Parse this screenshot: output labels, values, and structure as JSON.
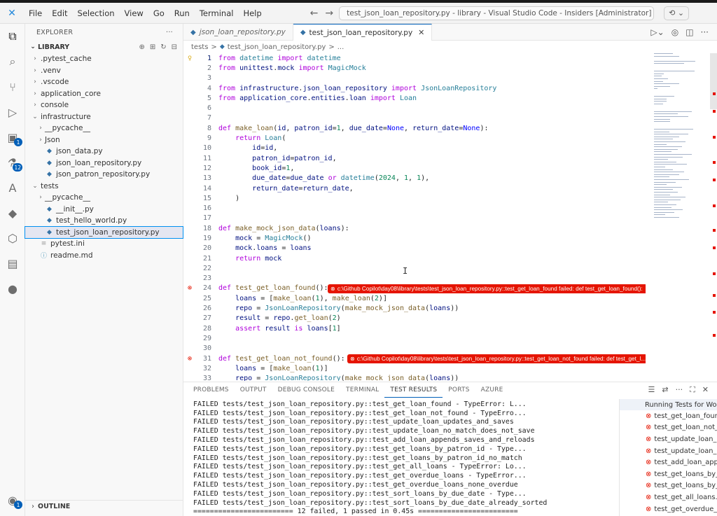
{
  "window": {
    "title": "test_json_loan_repository.py - library - Visual Studio Code - Insiders [Administrator]",
    "menu": [
      "File",
      "Edit",
      "Selection",
      "View",
      "Go",
      "Run",
      "Terminal",
      "Help"
    ]
  },
  "activity_bar": {
    "items": [
      {
        "name": "explorer-icon",
        "glyph": "⧉",
        "badge": ""
      },
      {
        "name": "search-icon",
        "glyph": "⌕",
        "badge": ""
      },
      {
        "name": "source-control-icon",
        "glyph": "⑂",
        "badge": ""
      },
      {
        "name": "run-debug-icon",
        "glyph": "▷",
        "badge": ""
      },
      {
        "name": "extensions-icon",
        "glyph": "▣",
        "badge": "1"
      },
      {
        "name": "testing-icon",
        "glyph": "⚗",
        "badge": "12"
      },
      {
        "name": "azure-icon",
        "glyph": "A",
        "badge": ""
      },
      {
        "name": "python-icon",
        "glyph": "◆",
        "badge": ""
      },
      {
        "name": "copilot-icon",
        "glyph": "⬡",
        "badge": ""
      },
      {
        "name": "m365-icon",
        "glyph": "▤",
        "badge": ""
      },
      {
        "name": "github-icon",
        "glyph": "●",
        "badge": ""
      }
    ],
    "account_badge": "1"
  },
  "sidebar": {
    "title": "EXPLORER",
    "section": "LIBRARY",
    "tree": [
      {
        "label": ".pytest_cache",
        "depth": 1,
        "kind": "folder-closed"
      },
      {
        "label": ".venv",
        "depth": 1,
        "kind": "folder-closed"
      },
      {
        "label": ".vscode",
        "depth": 1,
        "kind": "folder-closed"
      },
      {
        "label": "application_core",
        "depth": 1,
        "kind": "folder-closed"
      },
      {
        "label": "console",
        "depth": 1,
        "kind": "folder-closed"
      },
      {
        "label": "infrastructure",
        "depth": 1,
        "kind": "folder-open"
      },
      {
        "label": "__pycache__",
        "depth": 2,
        "kind": "folder-closed"
      },
      {
        "label": "Json",
        "depth": 2,
        "kind": "folder-closed"
      },
      {
        "label": "json_data.py",
        "depth": 2,
        "kind": "py"
      },
      {
        "label": "json_loan_repository.py",
        "depth": 2,
        "kind": "py"
      },
      {
        "label": "json_patron_repository.py",
        "depth": 2,
        "kind": "py"
      },
      {
        "label": "tests",
        "depth": 1,
        "kind": "folder-open"
      },
      {
        "label": "__pycache__",
        "depth": 2,
        "kind": "folder-closed"
      },
      {
        "label": "__init__.py",
        "depth": 2,
        "kind": "py"
      },
      {
        "label": "test_hello_world.py",
        "depth": 2,
        "kind": "py"
      },
      {
        "label": "test_json_loan_repository.py",
        "depth": 2,
        "kind": "py",
        "selected": true
      },
      {
        "label": "pytest.ini",
        "depth": 1,
        "kind": "ini"
      },
      {
        "label": "readme.md",
        "depth": 1,
        "kind": "md"
      }
    ],
    "outline": "OUTLINE"
  },
  "editor": {
    "tabs": [
      {
        "label": "json_loan_repository.py",
        "active": false
      },
      {
        "label": "test_json_loan_repository.py",
        "active": true
      }
    ],
    "breadcrumb": [
      "tests",
      ">",
      "test_json_loan_repository.py",
      ">",
      "..."
    ],
    "lines": [
      {
        "n": "1",
        "text": "from datetime import datetime",
        "gutter": "bulb"
      },
      {
        "n": "2",
        "text": "from unittest.mock import MagicMock"
      },
      {
        "n": "3",
        "text": ""
      },
      {
        "n": "4",
        "text": "from infrastructure.json_loan_repository import JsonLoanRepository"
      },
      {
        "n": "5",
        "text": "from application_core.entities.loan import Loan"
      },
      {
        "n": "6",
        "text": ""
      },
      {
        "n": "7",
        "text": ""
      },
      {
        "n": "8",
        "text": "def make_loan(id, patron_id=1, due_date=None, return_date=None):"
      },
      {
        "n": "9",
        "text": "    return Loan("
      },
      {
        "n": "10",
        "text": "        id=id,"
      },
      {
        "n": "11",
        "text": "        patron_id=patron_id,"
      },
      {
        "n": "12",
        "text": "        book_id=1,"
      },
      {
        "n": "13",
        "text": "        due_date=due_date or datetime(2024, 1, 1),"
      },
      {
        "n": "14",
        "text": "        return_date=return_date,"
      },
      {
        "n": "15",
        "text": "    )"
      },
      {
        "n": "16",
        "text": ""
      },
      {
        "n": "17",
        "text": ""
      },
      {
        "n": "18",
        "text": "def make_mock_json_data(loans):"
      },
      {
        "n": "19",
        "text": "    mock = MagicMock()"
      },
      {
        "n": "20",
        "text": "    mock.loans = loans"
      },
      {
        "n": "21",
        "text": "    return mock"
      },
      {
        "n": "22",
        "text": ""
      },
      {
        "n": "23",
        "text": ""
      },
      {
        "n": "24",
        "text": "def test_get_loan_found():",
        "gutter": "err",
        "error": "c:\\Github Copilot\\day08\\library\\tests\\test_json_loan_repository.py::test_get_loan_found failed: def test_get_loan_found():"
      },
      {
        "n": "25",
        "text": "    loans = [make_loan(1), make_loan(2)]"
      },
      {
        "n": "26",
        "text": "    repo = JsonLoanRepository(make_mock_json_data(loans))"
      },
      {
        "n": "27",
        "text": "    result = repo.get_loan(2)"
      },
      {
        "n": "28",
        "text": "    assert result is loans[1]"
      },
      {
        "n": "29",
        "text": ""
      },
      {
        "n": "30",
        "text": ""
      },
      {
        "n": "31",
        "text": "def test_get_loan_not_found():",
        "gutter": "err",
        "error": "c:\\Github Copilot\\day08\\library\\tests\\test_json_loan_repository.py::test_get_loan_not_found failed: def test_get_l..."
      },
      {
        "n": "32",
        "text": "    loans = [make_loan(1)]"
      },
      {
        "n": "33",
        "text": "    repo = JsonLoanRepository(make_mock_json_data(loans))"
      }
    ]
  },
  "panel": {
    "tabs": [
      "PROBLEMS",
      "OUTPUT",
      "DEBUG CONSOLE",
      "TERMINAL",
      "TEST RESULTS",
      "PORTS",
      "AZURE"
    ],
    "active_tab": "TEST RESULTS",
    "output": [
      "FAILED tests/test_json_loan_repository.py::test_get_loan_found - TypeError: L...",
      "FAILED tests/test_json_loan_repository.py::test_get_loan_not_found - TypeErro...",
      "FAILED tests/test_json_loan_repository.py::test_update_loan_updates_and_saves",
      "FAILED tests/test_json_loan_repository.py::test_update_loan_no_match_does_not_save",
      "FAILED tests/test_json_loan_repository.py::test_add_loan_appends_saves_and_reloads",
      "FAILED tests/test_json_loan_repository.py::test_get_loans_by_patron_id - Type...",
      "FAILED tests/test_json_loan_repository.py::test_get_loans_by_patron_id_no_match",
      "FAILED tests/test_json_loan_repository.py::test_get_all_loans - TypeError: Lo...",
      "FAILED tests/test_json_loan_repository.py::test_get_overdue_loans - TypeError...",
      "FAILED tests/test_json_loan_repository.py::test_get_overdue_loans_none_overdue",
      "FAILED tests/test_json_loan_repository.py::test_sort_loans_by_due_date - Type...",
      "FAILED tests/test_json_loan_repository.py::test_sort_loans_by_due_date_already_sorted",
      "======================== 12 failed, 1 passed in 0.45s ========================"
    ],
    "results_header": "Running Tests for Wor...",
    "results": [
      "test_get_loan_foun...",
      "test_get_loan_not_...",
      "test_update_loan_...",
      "test_update_loan_...",
      "test_add_loan_app...",
      "test_get_loans_by_...",
      "test_get_loans_by_...",
      "test_get_all_loans...",
      "test_get_overdue_l..."
    ]
  },
  "colors": {
    "accent": "#005fb8",
    "error": "#e51400",
    "keyword": "#0000ff",
    "type": "#267f99",
    "function": "#795e26",
    "number": "#098658",
    "param": "#001080"
  }
}
